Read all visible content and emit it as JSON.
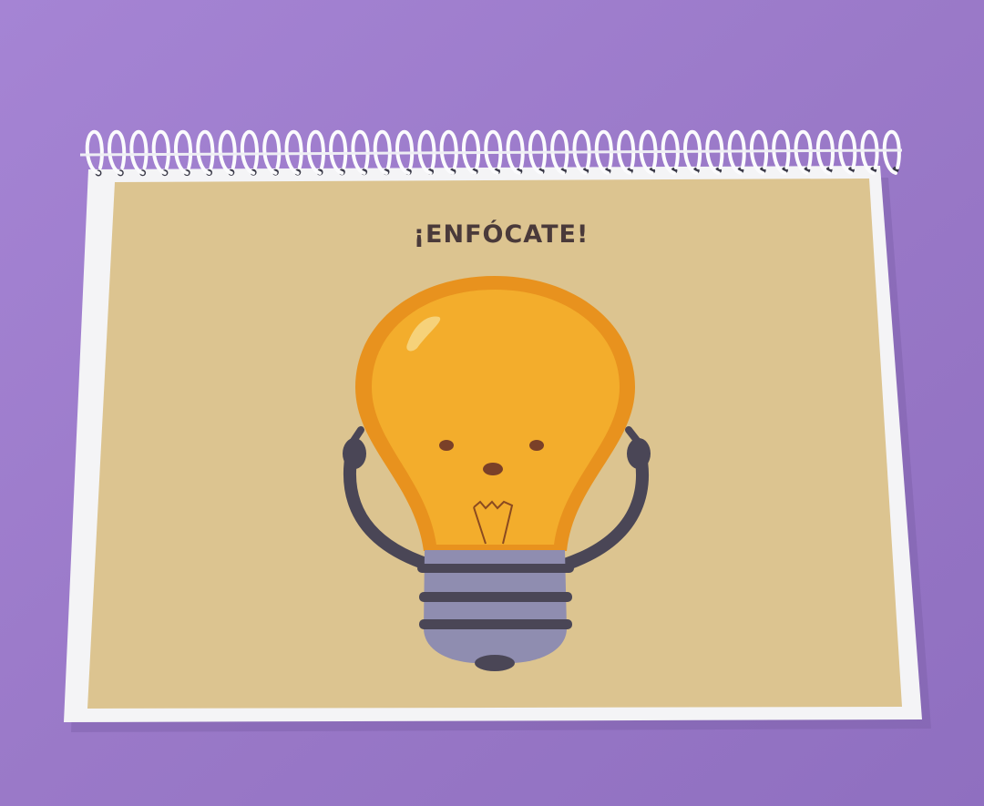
{
  "notebook": {
    "title": "¡ENFÓCATE!",
    "illustration": "lightbulb-character-pointing-at-head"
  },
  "colors": {
    "background": "#9b7bc9",
    "page": "#dcc490",
    "cover_border": "#f4f4f6",
    "bulb_outer": "#e8921e",
    "bulb_inner": "#f3ad2c",
    "bulb_base": "#8f8db0",
    "dark": "#4a4656"
  }
}
